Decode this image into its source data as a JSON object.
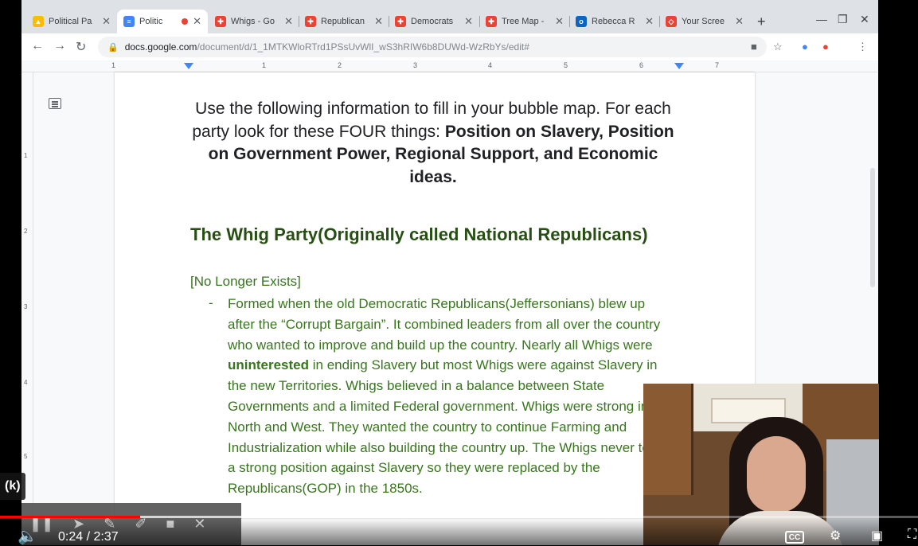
{
  "browser": {
    "tabs": [
      {
        "title": "Political Pa",
        "color": "#fbbc04",
        "glyph": "▲"
      },
      {
        "title": "Politic",
        "color": "#4285f4",
        "glyph": "≡",
        "recording": true
      },
      {
        "title": "Whigs - Go",
        "color": "#ea4335",
        "glyph": "✚"
      },
      {
        "title": "Republican",
        "color": "#ea4335",
        "glyph": "✚"
      },
      {
        "title": "Democrats",
        "color": "#ea4335",
        "glyph": "✚"
      },
      {
        "title": "Tree Map -",
        "color": "#ea4335",
        "glyph": "✚"
      },
      {
        "title": "Rebecca R",
        "color": "#0a66c2",
        "glyph": "o"
      },
      {
        "title": "Your Scree",
        "color": "#ea4335",
        "glyph": "◇"
      }
    ],
    "url_host": "docs.google.com",
    "url_path": "/document/d/1_1MTKWloRTrd1PSsUvWlI_wS3hRIW6b8DUWd-WzRbYs/edit#"
  },
  "ruler": {
    "numbers": [
      "1",
      "1",
      "2",
      "3",
      "4",
      "5",
      "6",
      "7"
    ]
  },
  "vruler": {
    "numbers": [
      "1",
      "2",
      "3",
      "4",
      "5"
    ]
  },
  "document": {
    "intro_plain": "Use the following information to fill in your bubble map. For each party look for these FOUR things: ",
    "intro_bold": "Position on Slavery, Position on Government Power, Regional Support, and Economic ideas.",
    "heading": "The Whig Party(Originally called National Republicans)",
    "subheading": "[No Longer Exists]",
    "bullet": "-",
    "para_1": "Formed when the old Democratic Republicans(Jeffersonians) blew up after the “Corrupt Bargain”. It combined leaders from all over the country who wanted to improve and build up the country. Nearly all Whigs were ",
    "para_bold": "uninterested",
    "para_2": " in ending Slavery but most Whigs were against Slavery in the new Territories. Whigs believed in a balance between State Governments and a limited Federal government. Whigs were strong in the North and West. They wanted the country to continue Farming and Industrialization while also building the country up. The Whigs never took a strong position against Slavery so they were replaced by the Republicans(GOP) in the 1850s."
  },
  "player": {
    "current_time": "0:24",
    "duration": "2:37",
    "time_display": "0:24 / 2:37",
    "progress_played": 0.153,
    "progress_loaded": 0.58,
    "shortcut_badge": "(k)",
    "cc_label": "CC"
  }
}
